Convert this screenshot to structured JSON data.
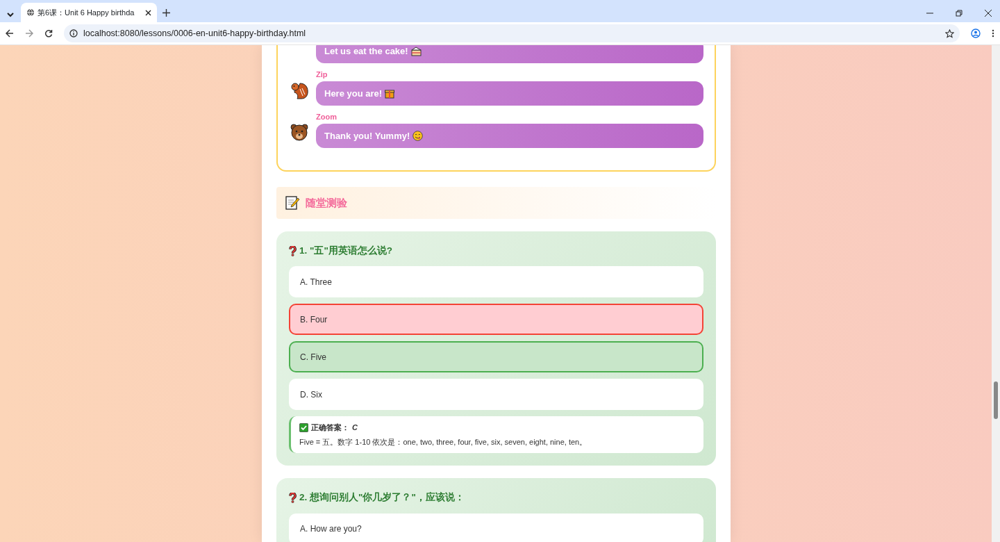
{
  "browser": {
    "tab_title": "第6课：Unit 6 Happy birthda",
    "url": "localhost:8080/lessons/0006-en-unit6-happy-birthday.html"
  },
  "dialogue": [
    {
      "text": "Let us eat the cake!"
    },
    {
      "speaker": "Zip",
      "text": "Here you are!"
    },
    {
      "speaker": "Zoom",
      "text": "Thank you! Yummy!"
    }
  ],
  "quiz_heading": "随堂测验",
  "questions": [
    {
      "number": "1.",
      "question": "\"五\"用英语怎么说?",
      "options": [
        {
          "text": "A. Three",
          "selected": false,
          "correct": false
        },
        {
          "text": "B. Four",
          "selected": true,
          "correct": false
        },
        {
          "text": "C. Five",
          "selected": false,
          "correct": true
        },
        {
          "text": "D. Six",
          "selected": false,
          "correct": false
        }
      ],
      "answer": {
        "label": "正确答案：",
        "value": "C",
        "explanation": "Five = 五。数字 1-10 依次是：one, two, three, four, five, six, seven, eight, nine, ten。"
      }
    },
    {
      "number": "2.",
      "question": "想询问别人\"你几岁了？\"，应该说：",
      "options": [
        {
          "text": "A. How are you?",
          "selected": false,
          "correct": false
        }
      ]
    }
  ]
}
